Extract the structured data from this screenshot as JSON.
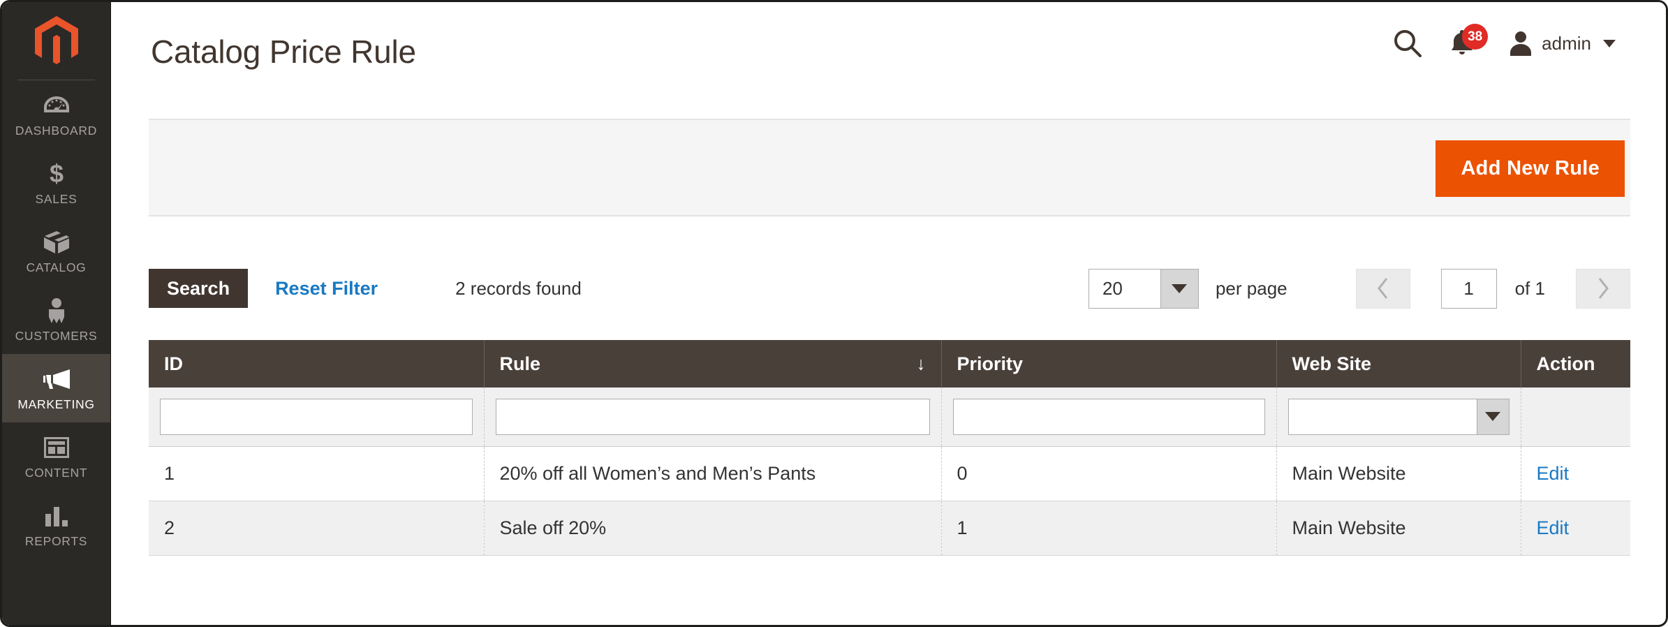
{
  "sidebar": {
    "logo_name": "magento-logo",
    "items": [
      {
        "label": "DASHBOARD",
        "icon": "dashboard-icon",
        "active": false
      },
      {
        "label": "SALES",
        "icon": "dollar-icon",
        "active": false
      },
      {
        "label": "CATALOG",
        "icon": "box-icon",
        "active": false
      },
      {
        "label": "CUSTOMERS",
        "icon": "person-icon",
        "active": false
      },
      {
        "label": "MARKETING",
        "icon": "megaphone-icon",
        "active": true
      },
      {
        "label": "CONTENT",
        "icon": "layout-icon",
        "active": false
      },
      {
        "label": "REPORTS",
        "icon": "bar-chart-icon",
        "active": false
      }
    ]
  },
  "header": {
    "title": "Catalog Price Rule",
    "search_icon": "search-icon",
    "notifications_icon": "bell-icon",
    "notifications_count": "38",
    "user_icon": "user-icon",
    "user_name": "admin",
    "user_caret": "chevron-down-icon"
  },
  "page_actions": {
    "add_new_rule_label": "Add New Rule"
  },
  "toolbar": {
    "search_label": "Search",
    "reset_filter_label": "Reset Filter",
    "records_found": "2 records found",
    "per_page_value": "20",
    "per_page_label": "per page",
    "prev_icon": "chevron-left-icon",
    "next_icon": "chevron-right-icon",
    "current_page": "1",
    "of_pages": "of 1"
  },
  "grid": {
    "columns": [
      {
        "label": "ID",
        "sorted": false
      },
      {
        "label": "Rule",
        "sorted": true,
        "sort_arrow": "↓"
      },
      {
        "label": "Priority",
        "sorted": false
      },
      {
        "label": "Web Site",
        "sorted": false
      },
      {
        "label": "Action",
        "sorted": false
      }
    ],
    "filters": {
      "id": "",
      "rule": "",
      "priority": "",
      "website": "",
      "website_placeholder": ""
    },
    "rows": [
      {
        "id": "1",
        "rule": "20% off all Women’s and Men’s Pants",
        "priority": "0",
        "website": "Main Website",
        "action": "Edit"
      },
      {
        "id": "2",
        "rule": "Sale off 20%",
        "priority": "1",
        "website": "Main Website",
        "action": "Edit"
      }
    ]
  },
  "colors": {
    "accent_orange": "#eb5202",
    "sidebar_bg": "#2b2926",
    "sidebar_active": "#4a443f",
    "header_row": "#4a403a",
    "link_blue": "#1979c3",
    "badge_red": "#e02b27"
  }
}
